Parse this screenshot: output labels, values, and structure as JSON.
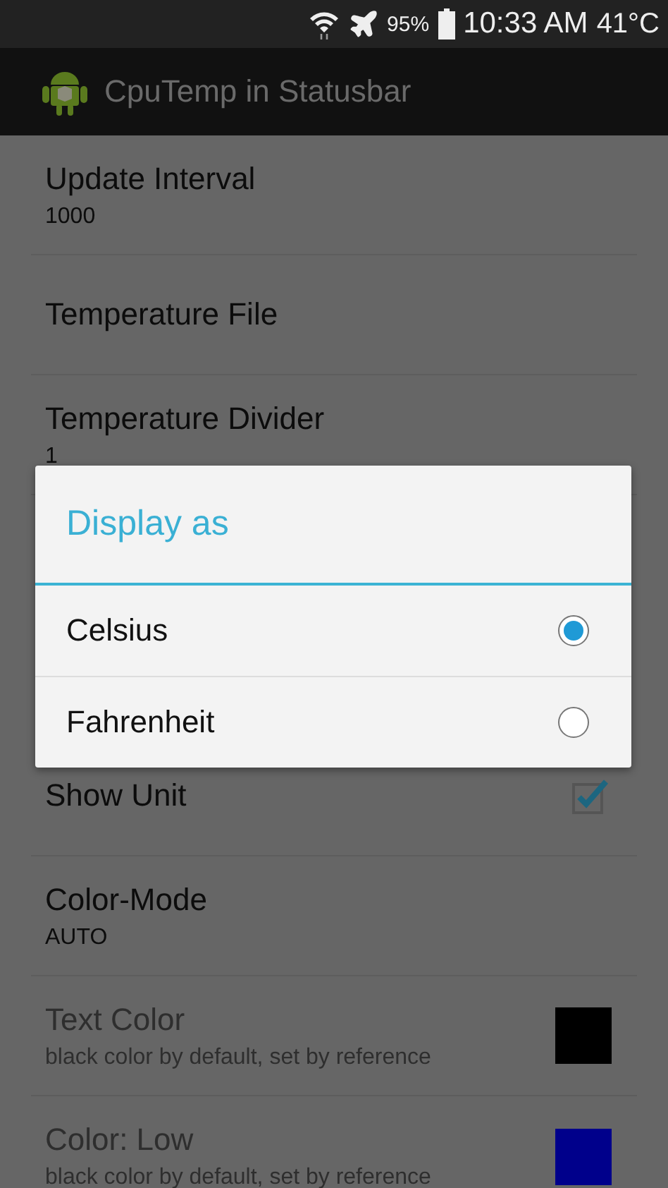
{
  "status_bar": {
    "battery": "95%",
    "time": "10:33 AM",
    "temperature": "41°C"
  },
  "app_bar": {
    "title": "CpuTemp in Statusbar"
  },
  "preferences": [
    {
      "kind": "text",
      "title": "Update Interval",
      "summary": "1000",
      "disabled": false
    },
    {
      "kind": "text",
      "title": "Temperature File",
      "disabled": false
    },
    {
      "kind": "text",
      "title": "Temperature Divider",
      "summary": "1",
      "disabled": false
    },
    {
      "kind": "hidden"
    },
    {
      "kind": "checkbox",
      "title": "Show Unit",
      "checked": true,
      "disabled": false
    },
    {
      "kind": "text",
      "title": "Color-Mode",
      "summary": "AUTO",
      "disabled": false
    },
    {
      "kind": "color",
      "title": "Text Color",
      "summary": "black color by default, set by reference",
      "color": "#000000",
      "disabled": true
    },
    {
      "kind": "color",
      "title": "Color: Low",
      "summary": "black color by default, set by reference",
      "color": "#00008b",
      "disabled": true
    }
  ],
  "dialog": {
    "title": "Display as",
    "options": [
      {
        "label": "Celsius",
        "selected": true
      },
      {
        "label": "Fahrenheit",
        "selected": false
      }
    ]
  }
}
